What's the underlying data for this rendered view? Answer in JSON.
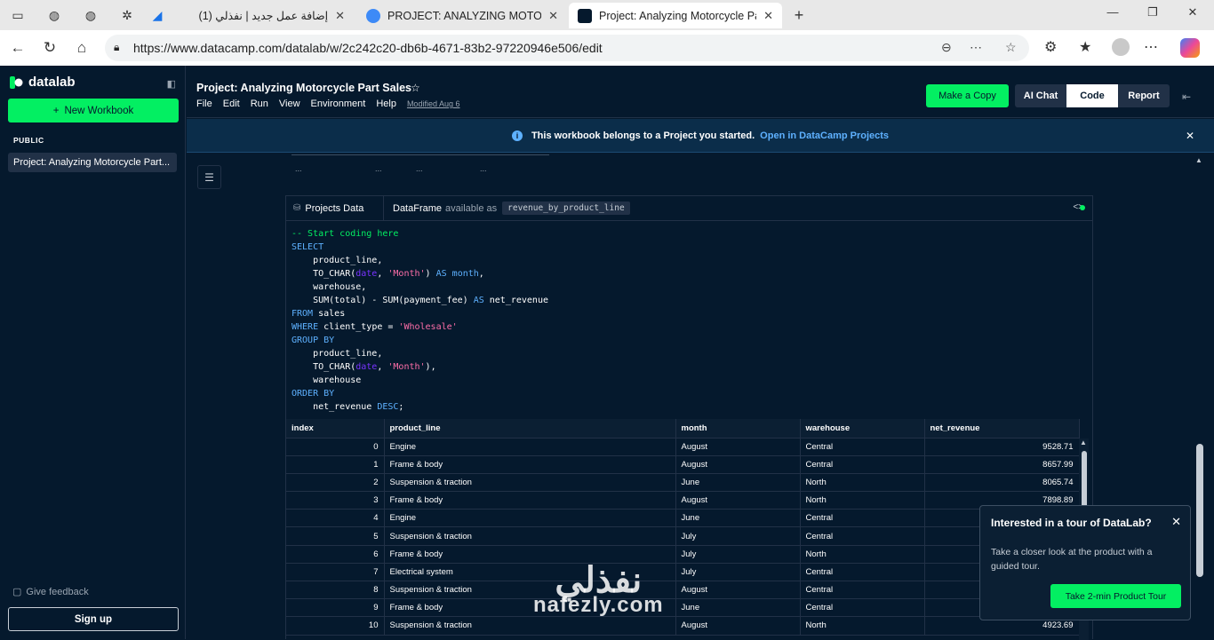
{
  "browser": {
    "tabs": [
      {
        "title": "(1) إضافة عمل جديد | نفذلي",
        "active": false
      },
      {
        "title": "PROJECT: ANALYZING MOTORCYCLE",
        "active": false
      },
      {
        "title": "Project: Analyzing Motorcycle Par",
        "active": true
      }
    ],
    "url": "https://www.datacamp.com/datalab/w/2c242c20-db6b-4671-83b2-97220946e506/edit"
  },
  "sidebar": {
    "logo_text": "datalab",
    "new_workbook_label": "New Workbook",
    "section_label": "PUBLIC",
    "workbooks": [
      "Project: Analyzing Motorcycle Part..."
    ],
    "feedback_label": "Give feedback",
    "signup_label": "Sign up"
  },
  "header": {
    "title": "Project: Analyzing Motorcycle Part Sales",
    "menus": [
      "File",
      "Edit",
      "Run",
      "View",
      "Environment",
      "Help"
    ],
    "modified": "Modified Aug 6",
    "make_copy_label": "Make a Copy",
    "view_tabs": [
      "AI Chat",
      "Code",
      "Report"
    ],
    "active_view": "Code"
  },
  "banner": {
    "text": "This workbook belongs to a Project you started.",
    "link": "Open in DataCamp Projects"
  },
  "prev_table_row": [
    "...",
    "...",
    "...",
    "..."
  ],
  "cell": {
    "source": "Projects Data",
    "df_label": "DataFrame",
    "available_as": "available as",
    "var_name": "revenue_by_product_line"
  },
  "result": {
    "columns": [
      "index",
      "product_line",
      "month",
      "warehouse",
      "net_revenue"
    ],
    "rows": [
      [
        "0",
        "Engine",
        "August",
        "Central",
        "9528.71"
      ],
      [
        "1",
        "Frame & body",
        "August",
        "Central",
        "8657.99"
      ],
      [
        "2",
        "Suspension & traction",
        "June",
        "North",
        "8065.74"
      ],
      [
        "3",
        "Frame & body",
        "August",
        "North",
        "7898.89"
      ],
      [
        "4",
        "Engine",
        "June",
        "Central",
        ""
      ],
      [
        "5",
        "Suspension & traction",
        "July",
        "Central",
        ""
      ],
      [
        "6",
        "Frame & body",
        "July",
        "North",
        ""
      ],
      [
        "7",
        "Electrical system",
        "July",
        "Central",
        ""
      ],
      [
        "8",
        "Suspension & traction",
        "August",
        "Central",
        ""
      ],
      [
        "9",
        "Frame & body",
        "June",
        "Central",
        ""
      ],
      [
        "10",
        "Suspension & traction",
        "August",
        "North",
        "4923.69"
      ]
    ]
  },
  "tour": {
    "title": "Interested in a tour of DataLab?",
    "body": "Take a closer look at the product with a guided tour.",
    "cta": "Take 2-min Product Tour"
  },
  "watermark": {
    "arabic": "نفذلي",
    "latin": "nafezly.com"
  },
  "colors": {
    "brand_green": "#03ef62",
    "navy": "#05192d",
    "blue_link": "#5eb1ff"
  }
}
